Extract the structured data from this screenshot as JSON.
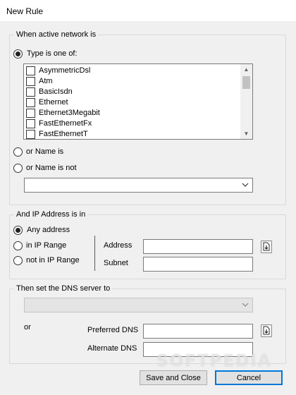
{
  "window": {
    "title": "New Rule"
  },
  "network_group": {
    "legend": "When active network is",
    "type_radio_label": "Type is one of:",
    "types": [
      {
        "label": "AsymmetricDsl",
        "checked": false
      },
      {
        "label": "Atm",
        "checked": false
      },
      {
        "label": "BasicIsdn",
        "checked": false
      },
      {
        "label": "Ethernet",
        "checked": false
      },
      {
        "label": "Ethernet3Megabit",
        "checked": false
      },
      {
        "label": "FastEthernetFx",
        "checked": false
      },
      {
        "label": "FastEthernetT",
        "checked": false
      }
    ],
    "name_is_label": "or Name is",
    "name_is_not_label": "or Name is not",
    "name_value": ""
  },
  "ip_group": {
    "legend": "And IP Address is in",
    "any_label": "Any address",
    "in_range_label": "in IP Range",
    "not_in_range_label": "not in IP Range",
    "address_label": "Address",
    "address_value": "",
    "subnet_label": "Subnet",
    "subnet_value": ""
  },
  "dns_group": {
    "legend": "Then set the DNS server to",
    "server_value": "",
    "or_label": "or",
    "preferred_label": "Preferred DNS",
    "preferred_value": "",
    "alternate_label": "Alternate DNS",
    "alternate_value": ""
  },
  "buttons": {
    "save_close": "Save and Close",
    "cancel": "Cancel"
  },
  "watermark": "SOFTPEDIA",
  "colors": {
    "accent": "#0078d7",
    "window_bg": "#f0f0f0",
    "border": "#7a7a7a"
  }
}
